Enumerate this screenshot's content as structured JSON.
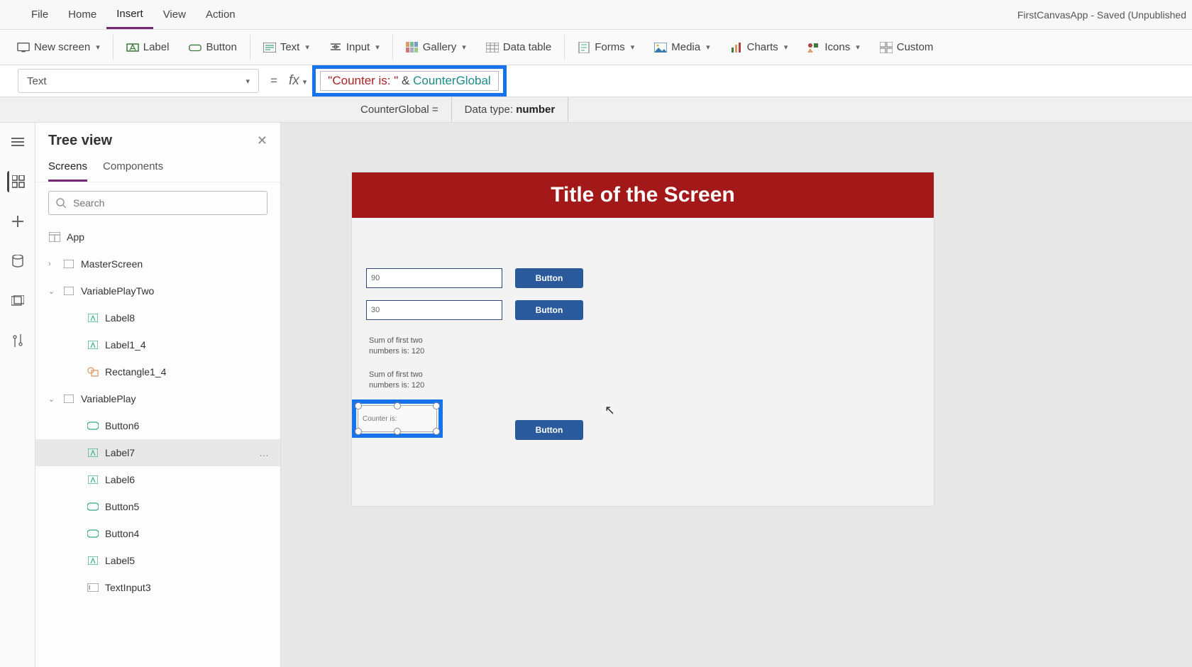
{
  "app_title": "FirstCanvasApp - Saved (Unpublished",
  "menubar": {
    "items": [
      "File",
      "Home",
      "Insert",
      "View",
      "Action"
    ],
    "active": "Insert"
  },
  "ribbon": {
    "newscreen": "New screen",
    "label": "Label",
    "button": "Button",
    "text": "Text",
    "input": "Input",
    "gallery": "Gallery",
    "datatable": "Data table",
    "forms": "Forms",
    "media": "Media",
    "charts": "Charts",
    "icons": "Icons",
    "custom": "Custom"
  },
  "formulabar": {
    "property": "Text",
    "eq": "=",
    "fx": "fx",
    "formula_str": "\"Counter is: \"",
    "formula_op": " & ",
    "formula_var": "CounterGlobal"
  },
  "formula_info": {
    "var_line": "CounterGlobal  =",
    "type_label": "Data type: ",
    "type_value": "number"
  },
  "tree": {
    "title": "Tree view",
    "tabs": {
      "screens": "Screens",
      "components": "Components"
    },
    "search_placeholder": "Search",
    "items": {
      "app": "App",
      "master": "MasterScreen",
      "varplay2": "VariablePlayTwo",
      "label8": "Label8",
      "label1_4": "Label1_4",
      "rect1_4": "Rectangle1_4",
      "varplay": "VariablePlay",
      "button6": "Button6",
      "label7": "Label7",
      "label6": "Label6",
      "button5": "Button5",
      "button4": "Button4",
      "label5": "Label5",
      "textinput3": "TextInput3"
    },
    "more": "…"
  },
  "canvas": {
    "title": "Title of the Screen",
    "input1": "90",
    "input2": "30",
    "button_label": "Button",
    "sum_text1": "Sum of first two numbers is: 120",
    "sum_text2": "Sum of first two numbers is: 120",
    "selected_label": "Counter is:"
  }
}
